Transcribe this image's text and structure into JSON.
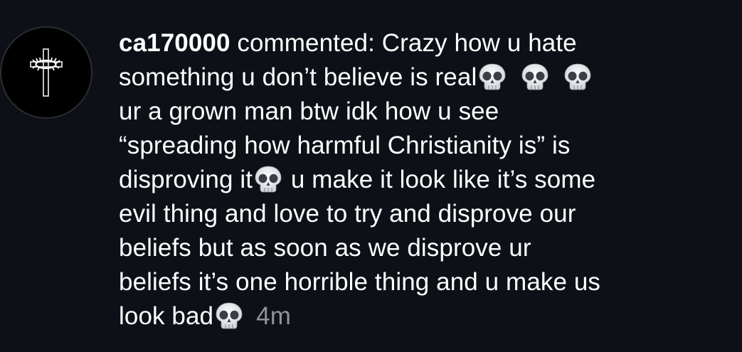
{
  "notification": {
    "username": "ca170000",
    "action": " commented: Crazy how u hate",
    "lines": [
      "something u don’t believe is real",
      "ur a grown man btw idk how u see",
      "“spreading how harmful Christianity is” is",
      "disproving it",
      " u make it look like it’s some",
      "evil thing and love to try and disprove our",
      "beliefs but as soon as we disprove ur",
      "beliefs it’s one horrible thing and u make us",
      "look bad"
    ],
    "timestamp": "4m",
    "icons": {
      "avatar": "cross-with-crown-of-thorns-icon",
      "emoji": "skull-emoji-icon"
    }
  },
  "colors": {
    "background": "#0d1117",
    "text": "#ffffff",
    "timestamp": "#8e939b"
  }
}
